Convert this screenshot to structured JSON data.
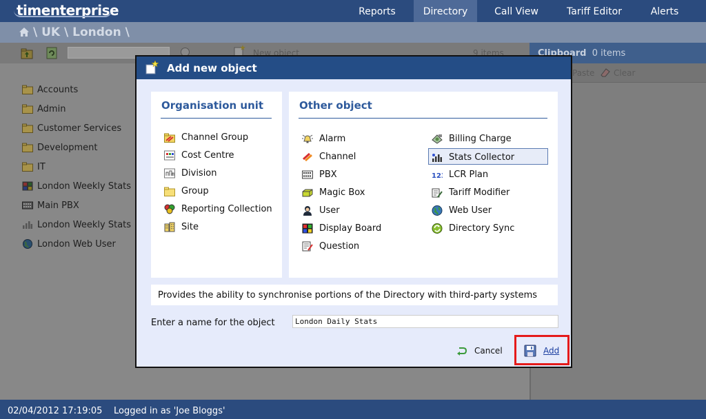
{
  "app": {
    "logo": "timenterprise"
  },
  "nav": {
    "items": [
      {
        "label": "Reports"
      },
      {
        "label": "Directory"
      },
      {
        "label": "Call View"
      },
      {
        "label": "Tariff Editor"
      },
      {
        "label": "Alerts"
      }
    ],
    "active": "Directory"
  },
  "breadcrumb": "\\ UK \\ London \\",
  "toolbar": {
    "new_object_label": "New object",
    "items_count": "9 items"
  },
  "clipboard": {
    "title": "Clipboard",
    "count": "0 items",
    "paste_label": "Paste",
    "clear_label": "Clear"
  },
  "tree": {
    "items": [
      {
        "label": "Accounts",
        "icon": "folder-icon"
      },
      {
        "label": "Admin",
        "icon": "folder-icon"
      },
      {
        "label": "Customer Services",
        "icon": "folder-icon"
      },
      {
        "label": "Development",
        "icon": "folder-icon"
      },
      {
        "label": "IT",
        "icon": "folder-icon"
      },
      {
        "label": "London Weekly Stats",
        "icon": "display-board-icon"
      },
      {
        "label": "Main PBX",
        "icon": "pbx-icon"
      },
      {
        "label": "London Weekly Stats",
        "icon": "stats-collector-icon"
      },
      {
        "label": "London Web User",
        "icon": "globe-icon"
      }
    ]
  },
  "dialog": {
    "title": "Add new object",
    "org_unit": {
      "title": "Organisation unit",
      "items": [
        {
          "label": "Channel Group",
          "icon": "channel-group-icon"
        },
        {
          "label": "Cost Centre",
          "icon": "cost-centre-icon"
        },
        {
          "label": "Division",
          "icon": "division-icon"
        },
        {
          "label": "Group",
          "icon": "folder-icon"
        },
        {
          "label": "Reporting Collection",
          "icon": "reporting-collection-icon"
        },
        {
          "label": "Site",
          "icon": "site-icon"
        }
      ]
    },
    "other_object": {
      "title": "Other object",
      "col1": [
        {
          "label": "Alarm",
          "icon": "alarm-icon"
        },
        {
          "label": "Channel",
          "icon": "channel-icon"
        },
        {
          "label": "PBX",
          "icon": "pbx-icon"
        },
        {
          "label": "Magic Box",
          "icon": "magic-box-icon"
        },
        {
          "label": "User",
          "icon": "user-icon"
        },
        {
          "label": "Display Board",
          "icon": "display-board-icon"
        },
        {
          "label": "Question",
          "icon": "question-icon"
        }
      ],
      "col2": [
        {
          "label": "Billing Charge",
          "icon": "billing-charge-icon"
        },
        {
          "label": "Stats Collector",
          "icon": "stats-collector-icon",
          "selected": true
        },
        {
          "label": "LCR Plan",
          "icon": "lcr-plan-icon"
        },
        {
          "label": "Tariff Modifier",
          "icon": "tariff-modifier-icon"
        },
        {
          "label": "Web User",
          "icon": "globe-icon"
        },
        {
          "label": "Directory Sync",
          "icon": "directory-sync-icon"
        }
      ]
    },
    "description": "Provides the ability to synchronise portions of the Directory with third-party systems",
    "name_label": "Enter a name for the object",
    "name_value": "London Daily Stats",
    "cancel_label": "Cancel",
    "add_label": "Add"
  },
  "status": {
    "datetime": "02/04/2012 17:19:05",
    "logged_in": "Logged in as 'Joe Bloggs'"
  },
  "colors": {
    "nav_bg": "#2b4b7e",
    "dialog_title_bg": "#244d86",
    "panel_heading": "#2e5a9c",
    "highlight": "#e51a1a"
  }
}
